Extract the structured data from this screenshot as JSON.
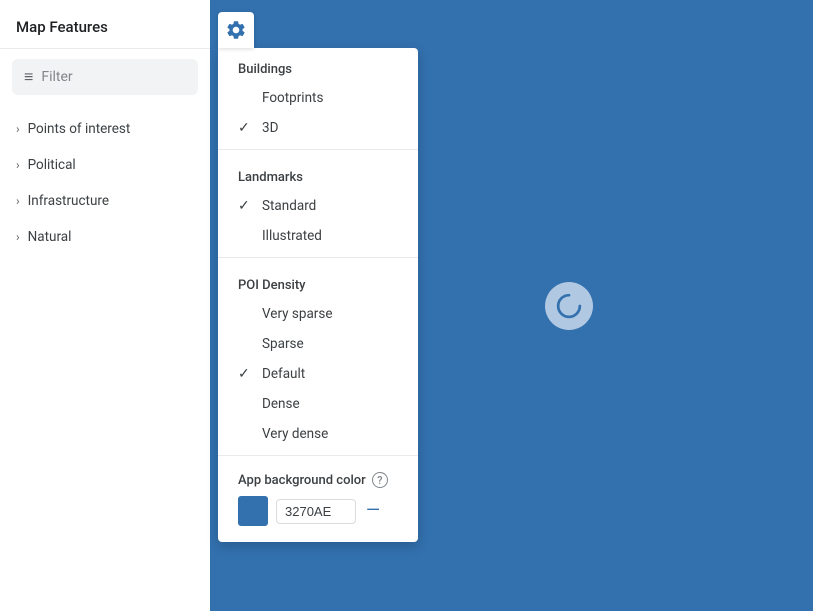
{
  "sidebar": {
    "title": "Map Features",
    "filter": {
      "placeholder": "Filter",
      "icon": "≡"
    },
    "items": [
      {
        "label": "Points of interest",
        "id": "poi"
      },
      {
        "label": "Political",
        "id": "political"
      },
      {
        "label": "Infrastructure",
        "id": "infrastructure"
      },
      {
        "label": "Natural",
        "id": "natural"
      }
    ]
  },
  "gear_button": {
    "aria_label": "Settings"
  },
  "dropdown": {
    "sections": [
      {
        "title": "Buildings",
        "items": [
          {
            "label": "Footprints",
            "checked": false
          },
          {
            "label": "3D",
            "checked": true
          }
        ]
      },
      {
        "title": "Landmarks",
        "items": [
          {
            "label": "Standard",
            "checked": true
          },
          {
            "label": "Illustrated",
            "checked": false
          }
        ]
      },
      {
        "title": "POI Density",
        "items": [
          {
            "label": "Very sparse",
            "checked": false
          },
          {
            "label": "Sparse",
            "checked": false
          },
          {
            "label": "Default",
            "checked": true
          },
          {
            "label": "Dense",
            "checked": false
          },
          {
            "label": "Very dense",
            "checked": false
          }
        ]
      }
    ],
    "app_background": {
      "label": "App background color",
      "help_icon": "?",
      "color_hex": "3270AE",
      "reset_icon": "—"
    }
  },
  "map": {
    "loading_icon": "C",
    "bg_color": "#3270AE"
  }
}
